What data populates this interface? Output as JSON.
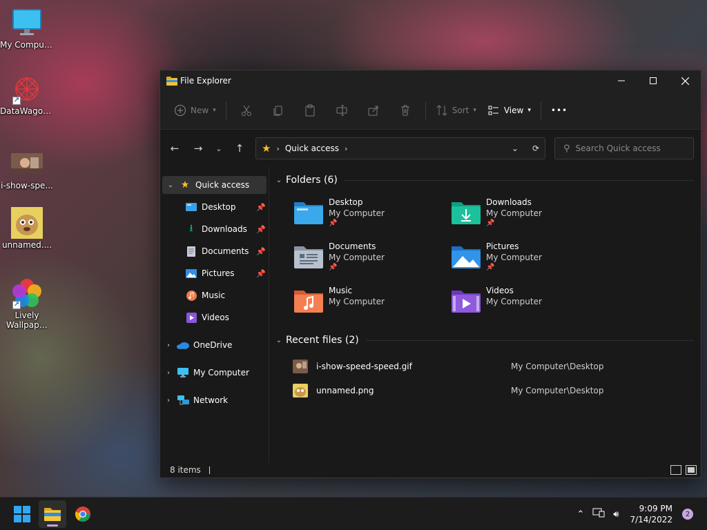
{
  "desktop": {
    "icons": [
      {
        "label": "My Computer"
      },
      {
        "label": "DataWagon..."
      },
      {
        "label": "i-show-spe..."
      },
      {
        "label": "unnamed...."
      },
      {
        "label": "Lively Wallpaper"
      }
    ]
  },
  "window": {
    "title": "File Explorer",
    "commands": {
      "new": "New",
      "sort": "Sort",
      "view": "View",
      "more": "•••"
    },
    "nav": {
      "address_path": "Quick access",
      "search_placeholder": "Search Quick access"
    },
    "sidebar": {
      "items": [
        {
          "label": "Quick access"
        },
        {
          "label": "Desktop"
        },
        {
          "label": "Downloads"
        },
        {
          "label": "Documents"
        },
        {
          "label": "Pictures"
        },
        {
          "label": "Music"
        },
        {
          "label": "Videos"
        },
        {
          "label": "OneDrive"
        },
        {
          "label": "My Computer"
        },
        {
          "label": "Network"
        }
      ]
    },
    "folders_header": "Folders (6)",
    "folders": [
      {
        "name": "Desktop",
        "location": "My Computer",
        "pinned": true
      },
      {
        "name": "Downloads",
        "location": "My Computer",
        "pinned": true
      },
      {
        "name": "Documents",
        "location": "My Computer",
        "pinned": true
      },
      {
        "name": "Pictures",
        "location": "My Computer",
        "pinned": true
      },
      {
        "name": "Music",
        "location": "My Computer",
        "pinned": false
      },
      {
        "name": "Videos",
        "location": "My Computer",
        "pinned": false
      }
    ],
    "recent_header": "Recent files (2)",
    "recent_files": [
      {
        "name": "i-show-speed-speed.gif",
        "path": "My Computer\\Desktop"
      },
      {
        "name": "unnamed.png",
        "path": "My Computer\\Desktop"
      }
    ],
    "status": {
      "item_count": "8 items"
    }
  },
  "taskbar": {
    "time": "9:09 PM",
    "date": "7/14/2022",
    "notification_count": "2"
  },
  "colors": {
    "accent_folder_blue": "#3aa0e6",
    "downloads_teal": "#1bbf9a",
    "music_orange": "#f07a4a",
    "videos_purple": "#8a55d8",
    "star_yellow": "#f7c02c"
  }
}
